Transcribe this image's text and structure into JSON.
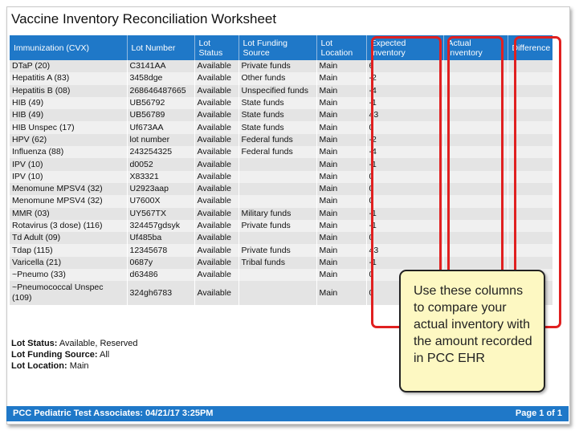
{
  "title": "Vaccine Inventory Reconciliation Worksheet",
  "columns": [
    "Immunization (CVX)",
    "Lot Number",
    "Lot Status",
    "Lot Funding Source",
    "Lot Location",
    "Expected Inventory",
    "Actual Inventory",
    "Difference"
  ],
  "rows": [
    [
      "DTaP (20)",
      "C3141AA",
      "Available",
      "Private funds",
      "Main",
      "6",
      "",
      ""
    ],
    [
      "Hepatitis A (83)",
      "3458dge",
      "Available",
      "Other funds",
      "Main",
      "-2",
      "",
      ""
    ],
    [
      "Hepatitis B (08)",
      "268646487665",
      "Available",
      "Unspecified funds",
      "Main",
      "-4",
      "",
      ""
    ],
    [
      "HIB (49)",
      "UB56792",
      "Available",
      "State funds",
      "Main",
      "-1",
      "",
      ""
    ],
    [
      "HIB (49)",
      "UB56789",
      "Available",
      "State funds",
      "Main",
      "43",
      "",
      ""
    ],
    [
      "HIB Unspec (17)",
      "Uf673AA",
      "Available",
      "State funds",
      "Main",
      "0",
      "",
      ""
    ],
    [
      "HPV (62)",
      "lot number",
      "Available",
      "Federal funds",
      "Main",
      "-2",
      "",
      ""
    ],
    [
      "Influenza (88)",
      "243254325",
      "Available",
      "Federal funds",
      "Main",
      "-4",
      "",
      ""
    ],
    [
      "IPV (10)",
      "d0052",
      "Available",
      "",
      "Main",
      "-1",
      "",
      ""
    ],
    [
      "IPV (10)",
      "X83321",
      "Available",
      "",
      "Main",
      "0",
      "",
      ""
    ],
    [
      "Menomune MPSV4 (32)",
      "U2923aap",
      "Available",
      "",
      "Main",
      "0",
      "",
      ""
    ],
    [
      "Menomune MPSV4 (32)",
      "U7600X",
      "Available",
      "",
      "Main",
      "0",
      "",
      ""
    ],
    [
      "MMR (03)",
      "UY567TX",
      "Available",
      "Military funds",
      "Main",
      "-1",
      "",
      ""
    ],
    [
      "Rotavirus (3 dose) (116)",
      "324457gdsyk",
      "Available",
      "Private funds",
      "Main",
      "-1",
      "",
      ""
    ],
    [
      "Td Adult (09)",
      "Uf485ba",
      "Available",
      "",
      "Main",
      "0",
      "",
      ""
    ],
    [
      "Tdap (115)",
      "12345678",
      "Available",
      "Private funds",
      "Main",
      "43",
      "",
      ""
    ],
    [
      "Varicella (21)",
      "0687y",
      "Available",
      "Tribal funds",
      "Main",
      "-1",
      "",
      ""
    ],
    [
      "~Pneumo (33)",
      "d63486",
      "Available",
      "",
      "Main",
      "0",
      "",
      ""
    ],
    [
      "~Pneumococcal Unspec (109)",
      "324gh6783",
      "Available",
      "",
      "Main",
      "0",
      "",
      ""
    ]
  ],
  "legend": {
    "status_label": "Lot Status:",
    "status_value": " Available, Reserved",
    "funding_label": "Lot Funding Source:",
    "funding_value": " All",
    "location_label": "Lot Location:",
    "location_value": " Main"
  },
  "footer": {
    "left": "PCC Pediatric Test Associates: 04/21/17 3:25PM",
    "right": "Page 1 of 1"
  },
  "callout": "Use these columns to compare your actual inventory with the amount recorded in PCC EHR",
  "colors": {
    "header_blue": "#1f78c8",
    "highlight_red": "#e02020",
    "callout_yellow": "#fdf8c2"
  }
}
